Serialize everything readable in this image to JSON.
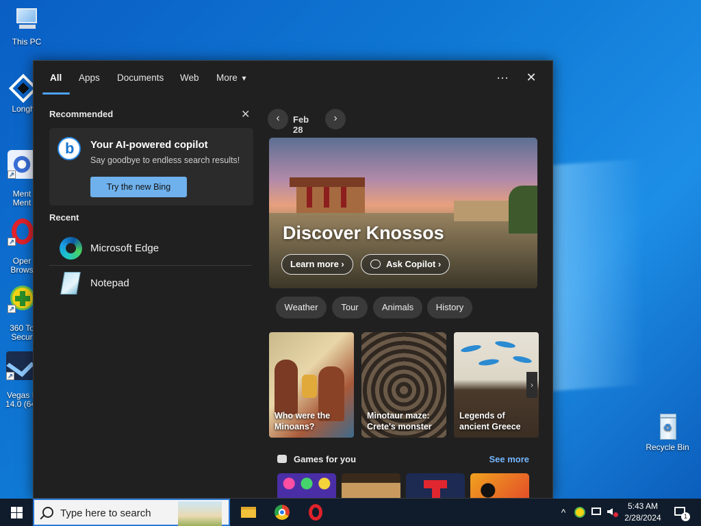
{
  "desktop": {
    "icons": [
      {
        "label": "This PC"
      },
      {
        "label": "Longh"
      },
      {
        "label": "Ment\nMent"
      },
      {
        "label": "Oper\nBrows"
      },
      {
        "label": "360 To\nSecur"
      },
      {
        "label": "Vegas I\n14.0 (64"
      }
    ],
    "recycle_bin": "Recycle Bin"
  },
  "search": {
    "tabs": [
      "All",
      "Apps",
      "Documents",
      "Web",
      "More"
    ],
    "more_caret": "▾",
    "options_glyph": "···",
    "close_glyph": "✕",
    "recommended": {
      "title": "Recommended",
      "close_glyph": "✕",
      "copilot_title": "Your AI-powered copilot",
      "copilot_sub": "Say goodbye to endless search results!",
      "button": "Try the new Bing"
    },
    "recent": {
      "title": "Recent",
      "apps": [
        "Microsoft Edge",
        "Notepad"
      ]
    },
    "highlights": {
      "date": "Feb 28",
      "prev": "‹",
      "next": "›",
      "hero_title": "Discover Knossos",
      "learn_more": "Learn more ›",
      "ask_copilot": "Ask Copilot ›",
      "chips": [
        "Weather",
        "Tour",
        "Animals",
        "History"
      ],
      "cards": [
        "Who were the Minoans?",
        "Minotaur maze: Crete's monster",
        "Legends of ancient Greece"
      ],
      "cards_next": "›",
      "games_title": "Games for you",
      "see_more": "See more"
    }
  },
  "taskbar": {
    "search_placeholder": "Type here to search",
    "tray_caret": "^",
    "time": "5:43 AM",
    "date": "2/28/2024",
    "notification_count": "1"
  }
}
